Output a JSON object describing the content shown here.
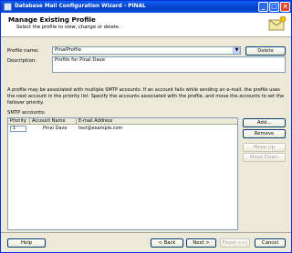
{
  "window": {
    "title": "Database Mail Configuration Wizard - PINAL"
  },
  "header": {
    "title": "Manage Existing Profile",
    "subtitle": "Select the profile to view, change or delete."
  },
  "profile": {
    "name_label": "Profile name:",
    "name_value": "PinalProfile",
    "delete_label": "Delete",
    "description_label": "Description:",
    "description_value": "Profile for Pinal Dave"
  },
  "info_text": "A profile may be associated with multiple SMTP accounts. If an account fails while sending an e-mail, the profile uses the next account in the priority list. Specify the accounts associated with the profile, and move the accounts to set the failover priority.",
  "smtp": {
    "label": "SMTP accounts:",
    "columns": [
      "Priority",
      "Account Name",
      "E-mail Address"
    ],
    "rows": [
      {
        "priority": "1",
        "account": "Pinal Dave",
        "email": "test@example.com"
      }
    ],
    "buttons": {
      "add": "Add...",
      "remove": "Remove",
      "move_up": "Move Up",
      "move_down": "Move Down"
    }
  },
  "footer": {
    "help": "Help",
    "back": "< Back",
    "next": "Next >",
    "finish": "Finish >>|",
    "cancel": "Cancel"
  }
}
